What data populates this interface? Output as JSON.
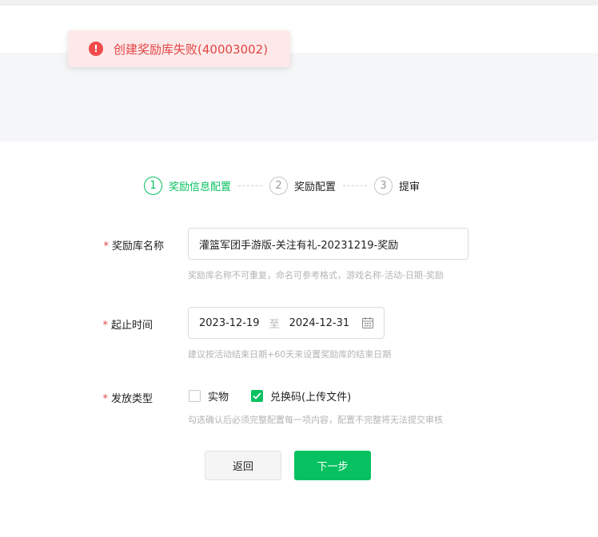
{
  "toast": {
    "message": "创建奖励库失败(40003002)",
    "icon": "error-icon",
    "color": "#e24545"
  },
  "steps": [
    {
      "number": "1",
      "label": "奖励信息配置",
      "active": true
    },
    {
      "number": "2",
      "label": "奖励配置",
      "active": false
    },
    {
      "number": "3",
      "label": "提审",
      "active": false
    }
  ],
  "form": {
    "name": {
      "label": "奖励库名称",
      "value": "灌篮军团手游版-关注有礼-20231219-奖励",
      "hint": "奖励库名称不可重复，命名可参考格式，游戏名称-活动-日期-奖励"
    },
    "period": {
      "label": "起止时间",
      "start": "2023-12-19",
      "separator": "至",
      "end": "2024-12-31",
      "hint": "建议按活动结束日期+60天来设置奖励库的结束日期"
    },
    "type": {
      "label": "发放类型",
      "options": [
        {
          "label": "实物",
          "checked": false
        },
        {
          "label": "兑换码(上传文件)",
          "checked": true
        }
      ],
      "hint": "勾选确认后必须完整配置每一项内容，配置不完整将无法提交审核"
    }
  },
  "buttons": {
    "back": "返回",
    "next": "下一步"
  },
  "colors": {
    "primary": "#07c160",
    "error": "#f04a4a",
    "required": "#e54545"
  }
}
